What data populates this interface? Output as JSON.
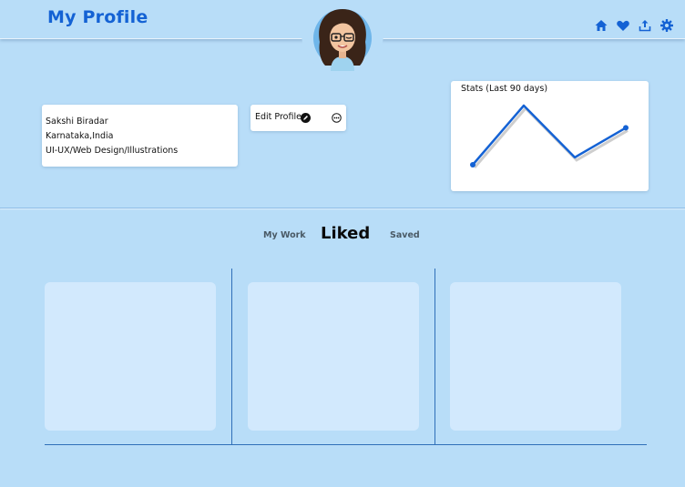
{
  "header": {
    "title": "My Profile",
    "icons": [
      "home-icon",
      "heart-icon",
      "upload-icon",
      "gear-icon"
    ],
    "accent_color": "#1462d4"
  },
  "profile": {
    "name": "Sakshi Biradar",
    "location": "Karnataka,India",
    "role": "UI-UX/Web Design/Illustrations",
    "edit_label": "Edit Profile"
  },
  "stats": {
    "title": "Stats (Last 90 days)",
    "points": [
      2,
      10,
      3,
      7
    ]
  },
  "tabs": [
    {
      "label": "My Work",
      "active": false
    },
    {
      "label": "Liked",
      "active": true
    },
    {
      "label": "Saved",
      "active": false
    }
  ],
  "tiles": [
    {
      "id": 1
    },
    {
      "id": 2
    },
    {
      "id": 3
    }
  ]
}
